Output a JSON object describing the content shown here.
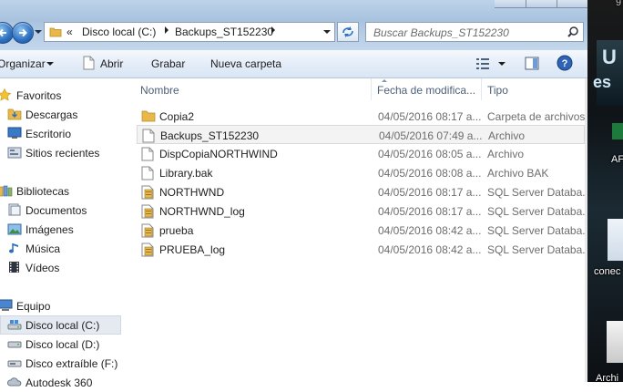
{
  "window": {
    "path_overflow": "«",
    "breadcrumbs": [
      "Disco local (C:)",
      "Backups_ST152230"
    ]
  },
  "search": {
    "placeholder": "Buscar Backups_ST152230"
  },
  "toolbar": {
    "organize": "Organizar",
    "open": "Abrir",
    "burn": "Grabar",
    "new_folder": "Nueva carpeta"
  },
  "sidebar": {
    "favorites": {
      "label": "Favoritos",
      "items": [
        {
          "label": "Descargas",
          "icon": "downloads-icon"
        },
        {
          "label": "Escritorio",
          "icon": "desktop-icon"
        },
        {
          "label": "Sitios recientes",
          "icon": "recent-places-icon"
        }
      ]
    },
    "libraries": {
      "label": "Bibliotecas",
      "items": [
        {
          "label": "Documentos",
          "icon": "documents-icon"
        },
        {
          "label": "Imágenes",
          "icon": "pictures-icon"
        },
        {
          "label": "Música",
          "icon": "music-icon"
        },
        {
          "label": "Vídeos",
          "icon": "videos-icon"
        }
      ]
    },
    "computer": {
      "label": "Equipo",
      "items": [
        {
          "label": "Disco local (C:)",
          "icon": "local-disk-icon",
          "selected": true
        },
        {
          "label": "Disco local (D:)",
          "icon": "local-disk-icon"
        },
        {
          "label": "Disco extraíble (F:)",
          "icon": "removable-disk-icon"
        },
        {
          "label": "Autodesk 360",
          "icon": "cloud-icon"
        }
      ]
    }
  },
  "columns": {
    "name": "Nombre",
    "date": "Fecha de modifica...",
    "type": "Tipo"
  },
  "files": [
    {
      "name": "Copia2",
      "date": "04/05/2016 08:17 a...",
      "type": "Carpeta de archivos",
      "icon": "folder-icon"
    },
    {
      "name": "Backups_ST152230",
      "date": "04/05/2016 07:49 a...",
      "type": "Archivo",
      "icon": "file-icon",
      "highlighted": true
    },
    {
      "name": "DispCopiaNORTHWIND",
      "date": "04/05/2016 08:05 a...",
      "type": "Archivo",
      "icon": "file-icon"
    },
    {
      "name": "Library.bak",
      "date": "04/05/2016 08:08 a...",
      "type": "Archivo BAK",
      "icon": "file-icon"
    },
    {
      "name": "NORTHWND",
      "date": "04/05/2016 08:17 a...",
      "type": "SQL Server Databa...",
      "icon": "sql-database-icon"
    },
    {
      "name": "NORTHWND_log",
      "date": "04/05/2016 08:17 a...",
      "type": "SQL Server Databa...",
      "icon": "sql-database-icon"
    },
    {
      "name": "prueba",
      "date": "04/05/2016 08:42 a...",
      "type": "SQL Server Databa...",
      "icon": "sql-database-icon"
    },
    {
      "name": "PRUEBA_log",
      "date": "04/05/2016 08:42 a...",
      "type": "SQL Server Databa...",
      "icon": "sql-database-icon"
    }
  ],
  "desktop": {
    "fragments": [
      "9",
      "U",
      "es",
      "AF",
      "conec",
      "Archi"
    ]
  },
  "colors": {
    "folder": "#e8b84a",
    "selection": "#e5eaf1",
    "toolbar": "#dce7f4"
  }
}
